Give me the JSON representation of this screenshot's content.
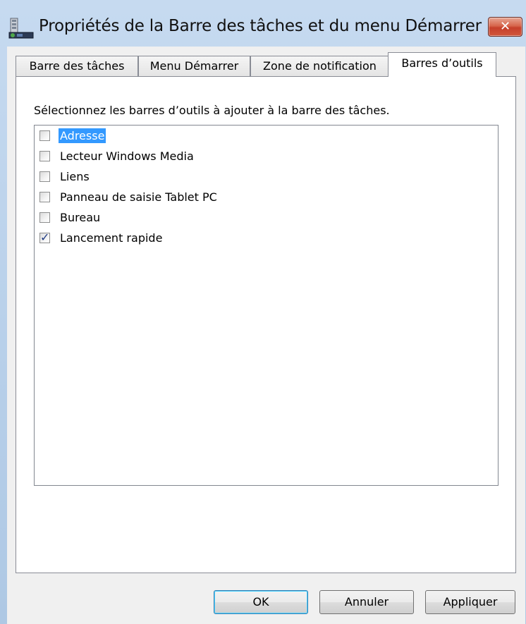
{
  "window": {
    "title": "Propriétés de la Barre des tâches et du menu Démarrer",
    "close_label": "✕"
  },
  "tabs": [
    {
      "label": "Barre des tâches",
      "active": false
    },
    {
      "label": "Menu Démarrer",
      "active": false
    },
    {
      "label": "Zone de notification",
      "active": false
    },
    {
      "label": "Barres d’outils",
      "active": true
    }
  ],
  "panel": {
    "instruction": "Sélectionnez les barres d’outils à ajouter à la barre des tâches.",
    "items": [
      {
        "label": "Adresse",
        "checked": false,
        "selected": true
      },
      {
        "label": "Lecteur Windows Media",
        "checked": false,
        "selected": false
      },
      {
        "label": "Liens",
        "checked": false,
        "selected": false
      },
      {
        "label": "Panneau de saisie Tablet PC",
        "checked": false,
        "selected": false
      },
      {
        "label": "Bureau",
        "checked": false,
        "selected": false
      },
      {
        "label": "Lancement rapide",
        "checked": true,
        "selected": false
      }
    ]
  },
  "buttons": {
    "ok": "OK",
    "cancel": "Annuler",
    "apply": "Appliquer"
  },
  "colors": {
    "selection": "#3399ff",
    "close_button": "#c6402b",
    "title_bar": "#b7cfe9"
  }
}
